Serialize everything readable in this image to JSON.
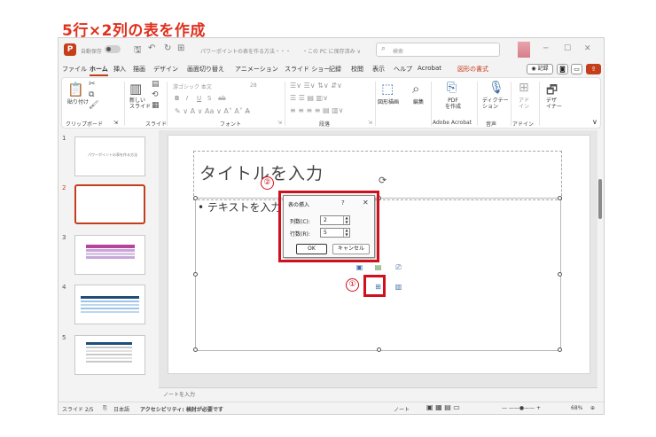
{
  "heading": "5行×2列の表を作成",
  "titlebar": {
    "autosave": "自動保存",
    "autosave_state": "オフ",
    "doc_title": "パワーポイントの表を作る方法・・・",
    "save_location": "・この PC に保存済み ∨",
    "search_placeholder": "検索"
  },
  "tabs": [
    "ファイル",
    "ホーム",
    "挿入",
    "描画",
    "デザイン",
    "画面切り替え",
    "アニメーション",
    "スライド ショー",
    "記録",
    "校閲",
    "表示",
    "ヘルプ",
    "Acrobat",
    "図形の書式"
  ],
  "tab_actions": {
    "record": "◉ 記録"
  },
  "ribbon": {
    "clipboard": {
      "paste": "貼り付け",
      "label": "クリップボード"
    },
    "slides": {
      "new_slide": "新しい\nスライド",
      "label": "スライド"
    },
    "font": {
      "font_name": "游ゴシック 本文",
      "font_size": "28",
      "bold": "B",
      "italic": "I",
      "underline": "U",
      "shadow": "S",
      "strike": "ab",
      "label": "フォント"
    },
    "paragraph": {
      "label": "段落"
    },
    "drawing": {
      "shapes": "図形描画",
      "edit": "編集"
    },
    "acrobat": {
      "pdf": "PDF\nを作成",
      "label": "Adobe Acrobat"
    },
    "voice": {
      "dictate": "ディクテー\nション",
      "label": "音声"
    },
    "addins": {
      "addin": "アド\nイン",
      "label": "アドイン"
    },
    "designer": {
      "label": "デザ\nイナー"
    }
  },
  "slides_pane": {
    "numbers": [
      "1",
      "2",
      "3",
      "4",
      "5"
    ],
    "thumb1_text": "パワーポイントの表を作る方法"
  },
  "slide": {
    "title_placeholder": "タイトルを入力",
    "body_placeholder": "• テキストを入力"
  },
  "dialog": {
    "title": "表の挿入",
    "help": "?",
    "close": "✕",
    "cols_label": "列数(C):",
    "cols_value": "2",
    "rows_label": "行数(R):",
    "rows_value": "5",
    "ok": "OK",
    "cancel": "キャンセル"
  },
  "annotations": {
    "step1": "①",
    "step2": "②"
  },
  "notes": "ノートを入力",
  "status": {
    "slide_of": "スライド 2/5",
    "language": "日本語",
    "accessibility": "アクセシビリティ: 検討が必要です",
    "notes_btn": "ノート",
    "zoom": "68%"
  },
  "colors": {
    "accent": "#c43e1c",
    "annotation": "#d0101c"
  }
}
